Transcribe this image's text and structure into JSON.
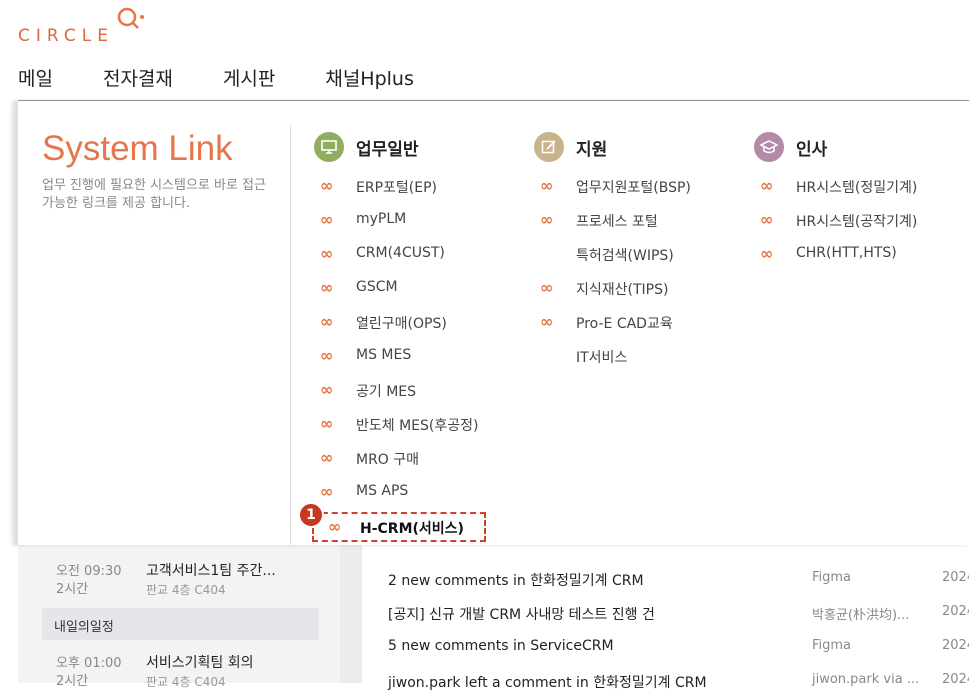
{
  "brand": {
    "logo_text": "CIRCLE",
    "accent": "#e4764a"
  },
  "nav": [
    "메일",
    "전자결재",
    "게시판",
    "채널Hplus"
  ],
  "system_link": {
    "title": "System Link",
    "description": "업무 진행에 필요한 시스템으로 바로 접근 가능한 링크를 제공 합니다.",
    "categories": [
      {
        "label": "업무일반",
        "icon": "monitor-icon",
        "color": "#8fae5f",
        "links": [
          {
            "label": "ERP포털(EP)",
            "icon": true
          },
          {
            "label": "myPLM",
            "icon": true
          },
          {
            "label": "CRM(4CUST)",
            "icon": true
          },
          {
            "label": "GSCM",
            "icon": true
          },
          {
            "label": "열린구매(OPS)",
            "icon": true
          },
          {
            "label": "MS MES",
            "icon": true
          },
          {
            "label": "공기 MES",
            "icon": true
          },
          {
            "label": "반도체 MES(후공정)",
            "icon": true
          },
          {
            "label": "MRO 구매",
            "icon": true
          },
          {
            "label": "MS APS",
            "icon": true
          },
          {
            "label": "H-CRM(서비스)",
            "icon": true
          }
        ]
      },
      {
        "label": "지원",
        "icon": "edit-icon",
        "color": "#c9b38f",
        "links": [
          {
            "label": "업무지원포털(BSP)",
            "icon": true
          },
          {
            "label": "프로세스 포털",
            "icon": true
          },
          {
            "label": "특허검색(WIPS)",
            "icon": false
          },
          {
            "label": "지식재산(TIPS)",
            "icon": true
          },
          {
            "label": "Pro-E CAD교육",
            "icon": true
          },
          {
            "label": "IT서비스",
            "icon": false
          }
        ]
      },
      {
        "label": "인사",
        "icon": "graduation-cap-icon",
        "color": "#b58aa8",
        "links": [
          {
            "label": "HR시스템(정밀기계)",
            "icon": true
          },
          {
            "label": "HR시스템(공작기계)",
            "icon": true
          },
          {
            "label": "CHR(HTT,HTS)",
            "icon": true
          }
        ]
      }
    ],
    "highlight_badge": "1"
  },
  "schedule": {
    "today": [
      {
        "time": "오전 09:30",
        "duration": "2시간",
        "title": "고객서비스1팀 주간...",
        "location": "판교 4층 C404"
      }
    ],
    "tomorrow_label": "내일의일정",
    "tomorrow": [
      {
        "time": "오후 01:00",
        "duration": "2시간",
        "title": "서비스기획팀 회의",
        "location": "판교 4층 C404"
      }
    ]
  },
  "notifications": [
    {
      "text": "2 new comments in 한화정밀기계 CRM",
      "source": "Figma",
      "date": "2024"
    },
    {
      "text": "[공지] 신규 개발 CRM 사내망 테스트 진행 건",
      "source": "박홍균(朴洪均)...",
      "date": "2024"
    },
    {
      "text": "5 new comments in ServiceCRM",
      "source": "Figma",
      "date": "2024"
    },
    {
      "text": "jiwon.park left a comment in 한화정밀기계 CRM",
      "source": "jiwon.park via ...",
      "date": "2024"
    }
  ]
}
